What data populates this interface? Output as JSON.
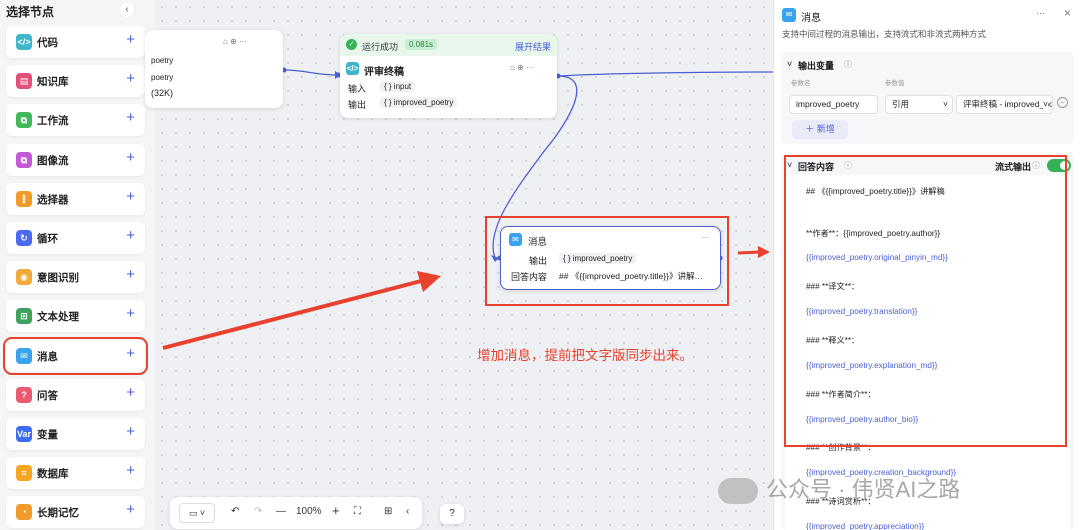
{
  "left_panel": {
    "title": "选择节点",
    "collapse": "‹",
    "items": [
      {
        "label": "代码",
        "icon": "code-icon",
        "glyph": "</>",
        "color": "#3fb6c9"
      },
      {
        "label": "知识库",
        "icon": "knowledge-icon",
        "glyph": "▤",
        "color": "#e0527a"
      },
      {
        "label": "工作流",
        "icon": "workflow-icon",
        "glyph": "⧉",
        "color": "#41b85a"
      },
      {
        "label": "图像流",
        "icon": "imageflow-icon",
        "glyph": "⧉",
        "color": "#c45ad6"
      },
      {
        "label": "选择器",
        "icon": "selector-icon",
        "glyph": "⫿",
        "color": "#f29b2a"
      },
      {
        "label": "循环",
        "icon": "loop-icon",
        "glyph": "↻",
        "color": "#4a6bf0"
      },
      {
        "label": "意图识别",
        "icon": "intent-icon",
        "glyph": "◉",
        "color": "#f2a93b"
      },
      {
        "label": "文本处理",
        "icon": "text-process-icon",
        "glyph": "⊞",
        "color": "#3da35d"
      },
      {
        "label": "消息",
        "icon": "message-icon",
        "glyph": "✉",
        "color": "#3aa3f0"
      },
      {
        "label": "问答",
        "icon": "qa-icon",
        "glyph": "?",
        "color": "#e85a6f"
      },
      {
        "label": "变量",
        "icon": "variable-icon",
        "glyph": "Var",
        "color": "#3c6cf0"
      },
      {
        "label": "数据库",
        "icon": "database-icon",
        "glyph": "≡",
        "color": "#f5a623"
      },
      {
        "label": "长期记忆",
        "icon": "memory-icon",
        "glyph": "◔",
        "color": "#f29b2a"
      }
    ],
    "plus": "+"
  },
  "canvas": {
    "partial_node": {
      "line1": "poetry",
      "line2": "poetry",
      "line3": "(32K)"
    },
    "review_node": {
      "status": "运行成功",
      "time": "0.081s",
      "expand": "展开结果",
      "title": "评审终稿",
      "input_label": "输入",
      "input_value": "input",
      "output_label": "输出",
      "output_value": "improved_poetry"
    },
    "message_node": {
      "title": "消息",
      "output_label": "输出",
      "output_value": "improved_poetry",
      "content_label": "回答内容",
      "content_value": "## 《{{improved_poetry.title}}》讲解…"
    },
    "annotation": "增加消息，提前把文字版同步出来。",
    "toolbar": {
      "zoom": "100%"
    }
  },
  "right_panel": {
    "title": "消息",
    "menu": "···",
    "close": "×",
    "description": "支持中间过程的消息输出，支持流式和非流式两种方式",
    "output": {
      "title": "输出变量",
      "col_name": "参数名",
      "col_value": "参数值",
      "var_name": "improved_poetry",
      "ref_type": "引用",
      "ref_value": "评审终稿 - improved_poetry",
      "add": "新增"
    },
    "answer": {
      "title": "回答内容",
      "stream_label": "流式输出",
      "lines": [
        "## 《{{improved_poetry.title}}》讲解稿",
        "",
        "**作者**：{{improved_poetry.author}}",
        "{{improved_poetry.original_pinyin_md}}",
        "### **译文**：",
        "{{improved_poetry.translation}}",
        "### **释义**：",
        "{{improved_poetry.explanation_md}}",
        "### **作者简介**：",
        "{{improved_poetry.author_bio}}",
        "### **创作背景**：",
        "{{improved_poetry.creation_background}}",
        "### **诗词赏析**：",
        "{{improved_poetry.appreciation}}"
      ]
    }
  },
  "watermark": "公众号 · 伟贤AI之路"
}
